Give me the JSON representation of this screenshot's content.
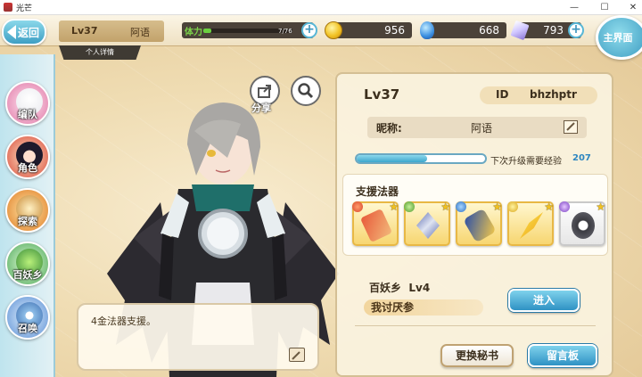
{
  "window": {
    "title": "光芒",
    "minimize": "—",
    "maximize": "☐",
    "close": "✕"
  },
  "topbar": {
    "back_label": "返回",
    "level": "Lv37",
    "name": "阿语",
    "subtab": "个人详情",
    "stamina_label": "体力",
    "stamina_text": "7/76",
    "stamina_fraction": 0.092,
    "gold": "956",
    "gems": "668",
    "crystals": "793",
    "plus": "+",
    "home_label": "主界面"
  },
  "leftnav": {
    "items": [
      {
        "label": "编队"
      },
      {
        "label": "角色"
      },
      {
        "label": "探索"
      },
      {
        "label": "百妖乡"
      },
      {
        "label": "召唤"
      }
    ]
  },
  "actions": {
    "share_label": "分享"
  },
  "bubble": {
    "text": "4金法器支援。"
  },
  "profile": {
    "level": "Lv37",
    "id_label": "ID",
    "id_value": "bhzhptr",
    "nickname_label": "昵称:",
    "nickname_value": "阿语",
    "exp_label": "下次升级需要经验",
    "exp_value": "207",
    "exp_fraction": 0.55,
    "support_title": "支援法器",
    "village_label": "百妖乡",
    "village_level": "Lv4",
    "village_name": "我讨厌参",
    "enter_label": "进入",
    "change_book_label": "更换秘书",
    "message_board_label": "留言板"
  },
  "colors": {
    "accent": "#3e9fc4",
    "panel": "#faf2de",
    "gold": "#f2c325"
  }
}
